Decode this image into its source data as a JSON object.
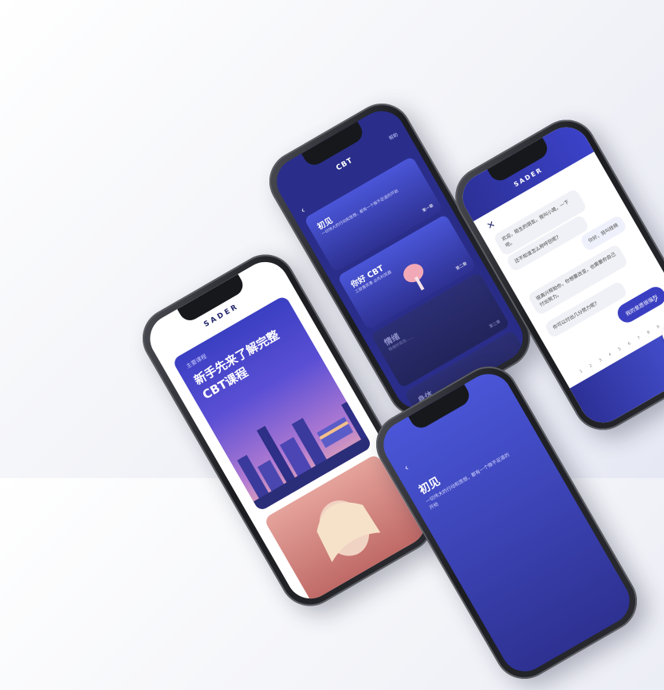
{
  "phone1": {
    "brand": "SADER",
    "card_subtitle": "主要课程",
    "card_title": "新手先来了解完整CBT课程"
  },
  "phone2": {
    "header": "CBT",
    "help": "帮助",
    "back": "‹",
    "stages": [
      {
        "name": "初见",
        "desc": "一切伟大的行动和思想，都有一个微不足道的开始",
        "num": "第一章"
      },
      {
        "name": "你好 CBT",
        "desc": "工欲善其事 必先利其器",
        "num": "第二章"
      },
      {
        "name": "情绪",
        "desc": "情绪的背后……",
        "num": "第三章"
      },
      {
        "name": "身体",
        "desc": "",
        "num": ""
      }
    ]
  },
  "phone3": {
    "brand": "SADER",
    "close": "✕",
    "messages": [
      {
        "side": "left",
        "text": "欢迎，陌生的朋友。我叫小简，一下吧。"
      },
      {
        "side": "left",
        "text": "还不知道怎么称呼您呢?"
      },
      {
        "side": "right",
        "text": "你好，我叫桂楠"
      },
      {
        "side": "left",
        "text": "很高兴帮助你，你想要改变，也需要你自己付出努力。"
      },
      {
        "side": "left",
        "text": "你可以付出几分努力呢?"
      }
    ],
    "option": "我的意愿很强烈",
    "check": "✓",
    "scale": [
      "1",
      "2",
      "3",
      "4",
      "5",
      "6",
      "7",
      "8",
      "9",
      "10"
    ]
  },
  "phone4": {
    "back": "‹",
    "title": "初见",
    "desc": "一切伟大的行动和思想，都有一个微不足道的开始"
  }
}
